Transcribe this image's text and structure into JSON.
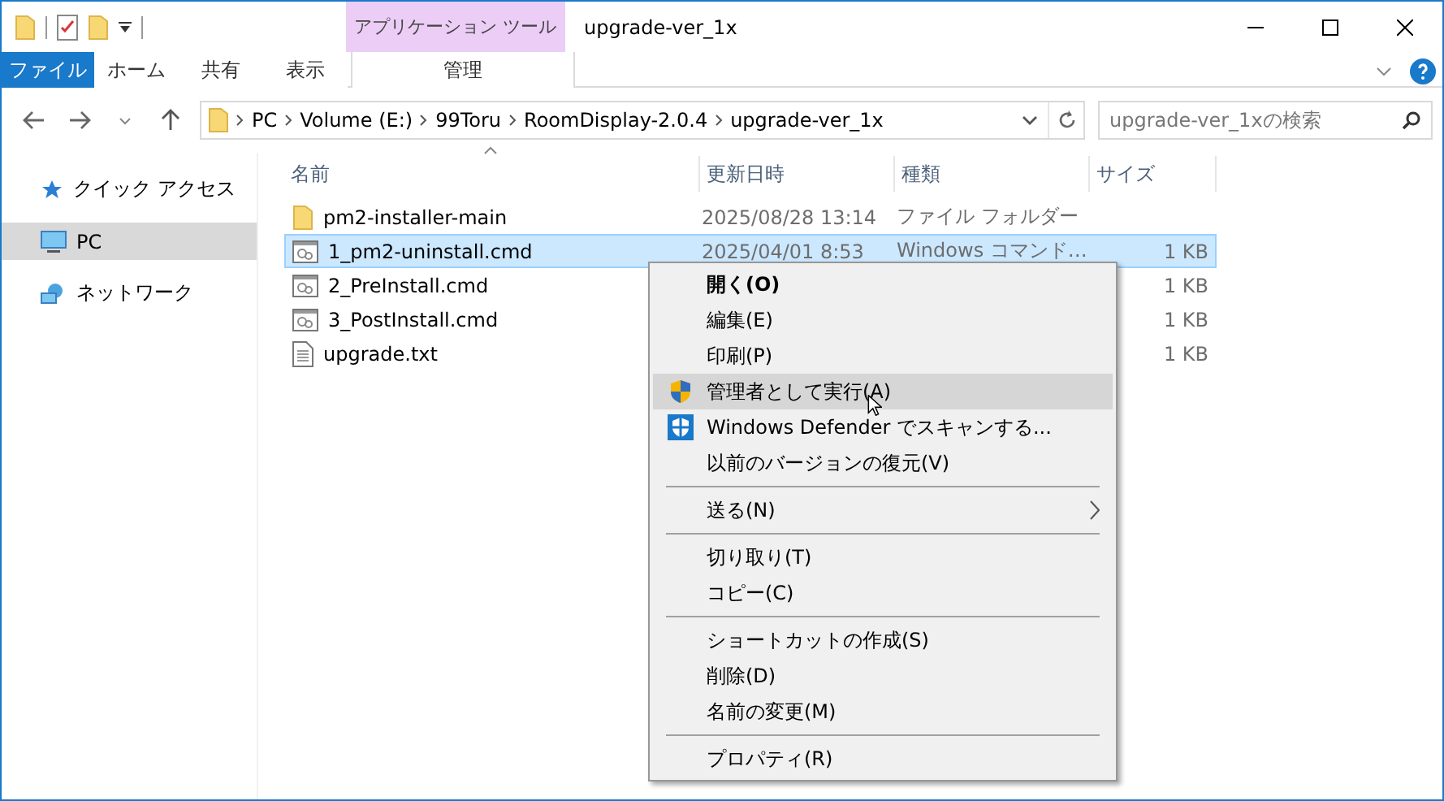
{
  "window": {
    "title": "upgrade-ver_1x",
    "tool_group": "アプリケーション ツール"
  },
  "ribbon_tabs": [
    {
      "label": "ファイル",
      "kind": "file"
    },
    {
      "label": "ホーム",
      "kind": "normal"
    },
    {
      "label": "共有",
      "kind": "normal"
    },
    {
      "label": "表示",
      "kind": "normal"
    },
    {
      "label": "管理",
      "kind": "contextual"
    }
  ],
  "address": {
    "path": [
      "PC",
      "Volume (E:)",
      "99Toru",
      "RoomDisplay-2.0.4",
      "upgrade-ver_1x"
    ]
  },
  "search": {
    "placeholder": "upgrade-ver_1xの検索"
  },
  "sidebar": {
    "items": [
      {
        "label": "クイック アクセス",
        "kind": "star",
        "selected": false
      },
      {
        "label": "PC",
        "kind": "pc",
        "selected": true
      },
      {
        "label": "ネットワーク",
        "kind": "network",
        "selected": false
      }
    ]
  },
  "table": {
    "columns": [
      "名前",
      "更新日時",
      "種類",
      "サイズ"
    ],
    "rows": [
      {
        "name": "pm2-installer-main",
        "kind": "folder",
        "date": "2025/08/28 13:14",
        "type": "ファイル フォルダー",
        "selected": false
      },
      {
        "name": "1_pm2-uninstall.cmd",
        "kind": "cmd",
        "date": "2025/04/01 8:53",
        "type": "Windows コマンド…",
        "size": "1 KB",
        "selected": true
      },
      {
        "name": "2_PreInstall.cmd",
        "kind": "cmd",
        "size": "1 KB",
        "selected": false
      },
      {
        "name": "3_PostInstall.cmd",
        "kind": "cmd",
        "size": "1 KB",
        "selected": false
      },
      {
        "name": "upgrade.txt",
        "kind": "text",
        "size": "1 KB",
        "selected": false
      }
    ]
  },
  "context_menu": {
    "groups": [
      {
        "items": [
          {
            "label": "開く(O)",
            "kind": "plain",
            "default": true,
            "hovered": false
          },
          {
            "label": "編集(E)",
            "kind": "plain",
            "default": false,
            "hovered": false
          },
          {
            "label": "印刷(P)",
            "kind": "plain",
            "default": false,
            "hovered": false
          },
          {
            "label": "管理者として実行(A)",
            "kind": "shield",
            "default": false,
            "hovered": true
          },
          {
            "label": "Windows Defender でスキャンする...",
            "kind": "defender",
            "default": false,
            "hovered": false
          },
          {
            "label": "以前のバージョンの復元(V)",
            "kind": "plain",
            "default": false,
            "hovered": false
          }
        ]
      },
      {
        "items": [
          {
            "label": "送る(N)",
            "kind": "submenu",
            "default": false,
            "hovered": false
          }
        ]
      },
      {
        "items": [
          {
            "label": "切り取り(T)",
            "kind": "plain",
            "default": false,
            "hovered": false
          },
          {
            "label": "コピー(C)",
            "kind": "plain",
            "default": false,
            "hovered": false
          }
        ]
      },
      {
        "items": [
          {
            "label": "ショートカットの作成(S)",
            "kind": "plain",
            "default": false,
            "hovered": false
          },
          {
            "label": "削除(D)",
            "kind": "plain",
            "default": false,
            "hovered": false
          },
          {
            "label": "名前の変更(M)",
            "kind": "plain",
            "default": false,
            "hovered": false
          }
        ]
      },
      {
        "items": [
          {
            "label": "プロパティ(R)",
            "kind": "plain",
            "default": false,
            "hovered": false
          }
        ]
      }
    ]
  }
}
